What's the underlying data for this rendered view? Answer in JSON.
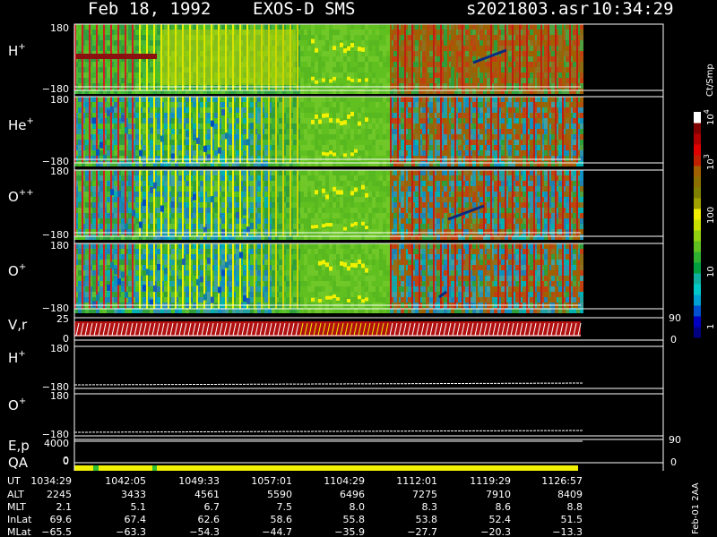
{
  "header": {
    "date": "Feb 18, 1992",
    "instrument": "EXOS-D SMS",
    "file": "s2021803.asr",
    "time": "10:34:29"
  },
  "side_note": "Feb-01 2AA",
  "chart_data": {
    "type": "heatmap",
    "panels": [
      {
        "id": "h",
        "label": "H",
        "sup": "+",
        "ytop": "180",
        "ybot": "−180"
      },
      {
        "id": "he",
        "label": "He",
        "sup": "+",
        "ytop": "180",
        "ybot": "−180"
      },
      {
        "id": "opp",
        "label": "O",
        "sup": "++",
        "ytop": "180",
        "ybot": "−180"
      },
      {
        "id": "op",
        "label": "O",
        "sup": "+",
        "ytop": "180",
        "ybot": "−180"
      },
      {
        "id": "vr",
        "label": "V,r",
        "sup": "",
        "ytop": "25",
        "ybot": "0",
        "rtop": "90",
        "rbot": "0"
      },
      {
        "id": "h2",
        "label": "H",
        "sup": "+",
        "ytop": "180",
        "ybot": "−180"
      },
      {
        "id": "o2",
        "label": "O",
        "sup": "+",
        "ytop": "180",
        "ybot": "−180"
      },
      {
        "id": "ep",
        "label": "E,p",
        "sup": "",
        "ytop": "4000",
        "ybot": "0",
        "rtop": "90",
        "rbot": "0"
      },
      {
        "id": "qa",
        "label": "QA",
        "sup": "",
        "ytop": "",
        "ybot": ""
      }
    ],
    "extra_tick": "0",
    "colorbar": {
      "title": "Ct/Smp",
      "ticks": [
        {
          "label": "10",
          "sup": "4"
        },
        {
          "label": "10",
          "sup": "3"
        },
        {
          "label": "100",
          "sup": ""
        },
        {
          "label": "10",
          "sup": ""
        },
        {
          "label": "1",
          "sup": ""
        }
      ],
      "colors": [
        "#000080",
        "#0000c0",
        "#0050d0",
        "#00a0d0",
        "#00c8c8",
        "#10b0a0",
        "#00a040",
        "#30b030",
        "#60c020",
        "#90d010",
        "#c8e000",
        "#f0f000",
        "#a0a000",
        "#808000",
        "#8b7000",
        "#a06000",
        "#c02000",
        "#e00000",
        "#b00000",
        "#800000",
        "#ffffff"
      ]
    },
    "ephemeris": {
      "labels": [
        "UT",
        "ALT",
        "MLT",
        "InLat",
        "MLat"
      ],
      "columns": [
        [
          "1034:29",
          "2245",
          "2.1",
          "69.6",
          "−65.5"
        ],
        [
          "1042:05",
          "3433",
          "5.1",
          "67.4",
          "−63.3"
        ],
        [
          "1049:33",
          "4561",
          "6.7",
          "62.6",
          "−54.3"
        ],
        [
          "1057:01",
          "5590",
          "7.5",
          "58.6",
          "−44.7"
        ],
        [
          "1104:29",
          "6496",
          "8.0",
          "55.8",
          "−35.9"
        ],
        [
          "1112:01",
          "7275",
          "8.3",
          "53.8",
          "−27.7"
        ],
        [
          "1119:29",
          "7910",
          "8.6",
          "52.4",
          "−20.3"
        ],
        [
          "1126:57",
          "8409",
          "8.8",
          "51.5",
          "−13.3"
        ]
      ]
    }
  }
}
